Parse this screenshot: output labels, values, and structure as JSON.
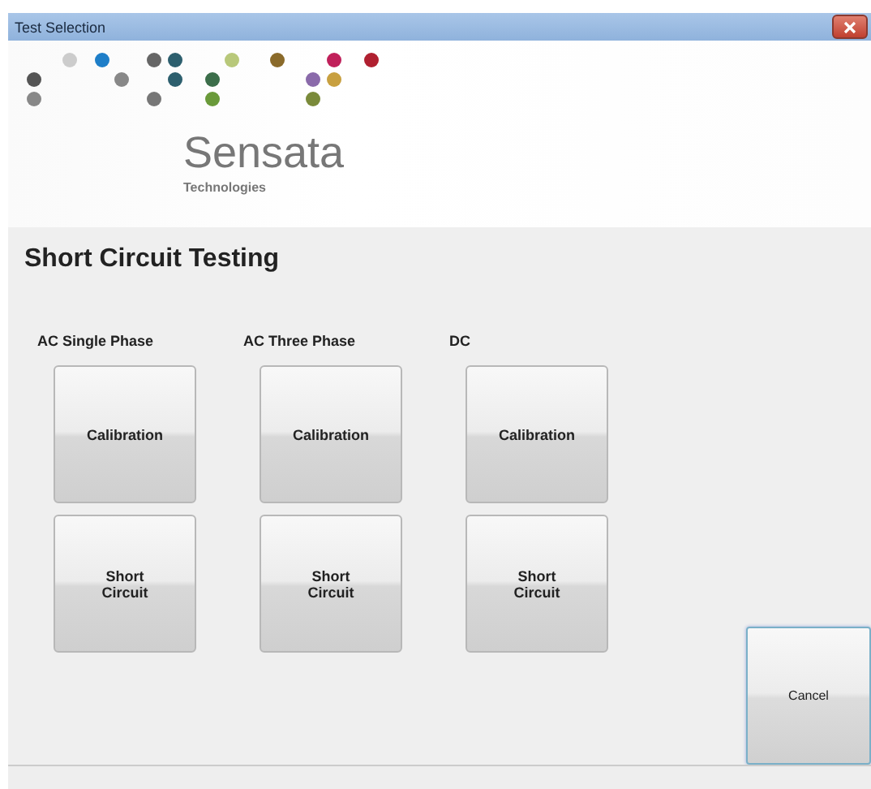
{
  "window": {
    "title": "Test Selection"
  },
  "logo": {
    "name": "Sensata",
    "tagline": "Technologies"
  },
  "heading": "Short Circuit Testing",
  "groups": [
    {
      "label": "AC Single Phase",
      "buttons": [
        "Calibration",
        "Short\nCircuit"
      ]
    },
    {
      "label": "AC Three Phase",
      "buttons": [
        "Calibration",
        "Short\nCircuit"
      ]
    },
    {
      "label": "DC",
      "buttons": [
        "Calibration",
        "Short\nCircuit"
      ]
    }
  ],
  "cancel_button": "Cancel"
}
